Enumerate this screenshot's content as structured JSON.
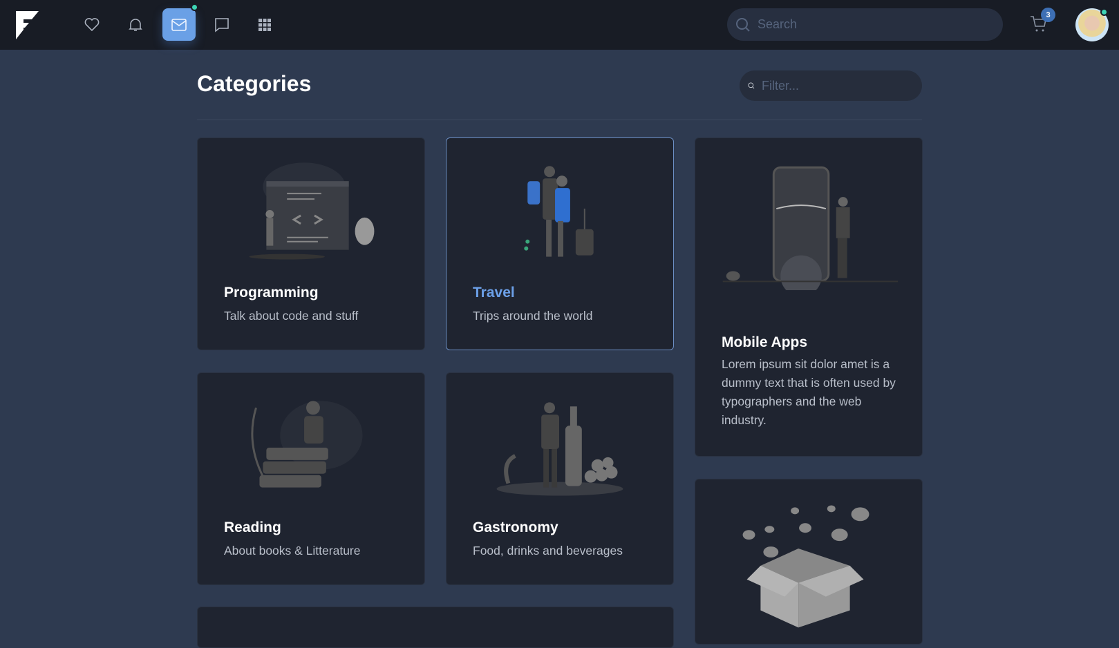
{
  "nav": {
    "icons": [
      "heart-icon",
      "bell-icon",
      "mail-icon",
      "chat-icon",
      "apps-grid-icon"
    ],
    "active": "mail-icon",
    "search_placeholder": "Search",
    "cart_count": "3",
    "accent": "#6aa0e6",
    "online_color": "#3dd5b5"
  },
  "page": {
    "title": "Categories",
    "filter_placeholder": "Filter..."
  },
  "cards": [
    {
      "title": "Programming",
      "description": "Talk about code and stuff"
    },
    {
      "title": "Travel",
      "description": "Trips around the world",
      "highlighted": true
    },
    {
      "title": "Mobile Apps",
      "description": "Lorem ipsum sit dolor amet is a dummy text that is often used by typographers and the web industry."
    },
    {
      "title": "Reading",
      "description": "About books & Litterature"
    },
    {
      "title": "Gastronomy",
      "description": "Food, drinks and beverages"
    }
  ]
}
